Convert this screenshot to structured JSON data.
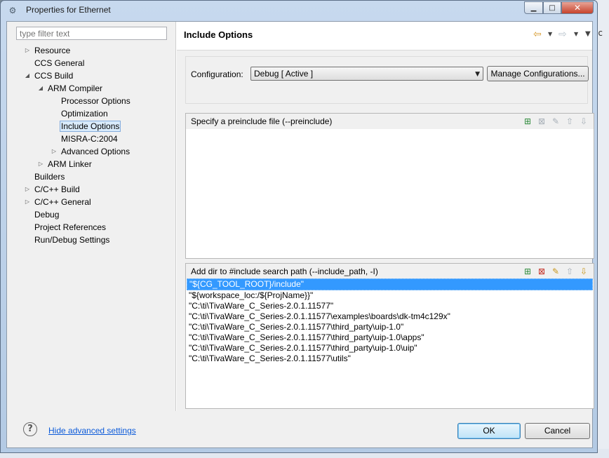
{
  "window": {
    "title": "Properties for Ethernet",
    "controls": [
      "minimize-icon",
      "maximize-icon",
      "close-icon"
    ]
  },
  "filter": {
    "placeholder": "type filter text"
  },
  "tree": {
    "items": [
      {
        "label": "Resource",
        "expander": "collapsed"
      },
      {
        "label": "CCS General",
        "expander": "none"
      },
      {
        "label": "CCS Build",
        "expander": "expanded"
      },
      {
        "label": "ARM Compiler",
        "expander": "expanded"
      },
      {
        "label": "Processor Options",
        "expander": "none"
      },
      {
        "label": "Optimization",
        "expander": "none"
      },
      {
        "label": "Include Options",
        "expander": "none",
        "selected": true
      },
      {
        "label": "MISRA-C:2004",
        "expander": "none"
      },
      {
        "label": "Advanced Options",
        "expander": "collapsed"
      },
      {
        "label": "ARM Linker",
        "expander": "collapsed"
      },
      {
        "label": "Builders",
        "expander": "none"
      },
      {
        "label": "C/C++ Build",
        "expander": "collapsed"
      },
      {
        "label": "C/C++ General",
        "expander": "collapsed"
      },
      {
        "label": "Debug",
        "expander": "none"
      },
      {
        "label": "Project References",
        "expander": "none"
      },
      {
        "label": "Run/Debug Settings",
        "expander": "none"
      }
    ]
  },
  "page": {
    "title": "Include Options"
  },
  "config": {
    "label": "Configuration:",
    "selected": "Debug  [ Active ]",
    "manage_label": "Manage Configurations..."
  },
  "preinclude": {
    "title": "Specify a preinclude file (--preinclude)",
    "items": []
  },
  "include_path": {
    "title": "Add dir to #include search path (--include_path, -I)",
    "items": [
      "\"${CG_TOOL_ROOT}/include\"",
      "\"${workspace_loc:/${ProjName}}\"",
      "\"C:\\ti\\TivaWare_C_Series-2.0.1.11577\"",
      "\"C:\\ti\\TivaWare_C_Series-2.0.1.11577\\examples\\boards\\dk-tm4c129x\"",
      "\"C:\\ti\\TivaWare_C_Series-2.0.1.11577\\third_party\\uip-1.0\"",
      "\"C:\\ti\\TivaWare_C_Series-2.0.1.11577\\third_party\\uip-1.0\\apps\"",
      "\"C:\\ti\\TivaWare_C_Series-2.0.1.11577\\third_party\\uip-1.0\\uip\"",
      "\"C:\\ti\\TivaWare_C_Series-2.0.1.11577\\utils\""
    ],
    "selected_index": 0
  },
  "footer": {
    "hide_link": "Hide advanced settings",
    "ok": "OK",
    "cancel": "Cancel"
  },
  "colors": {
    "selection": "#3399ff",
    "link": "#0b5ad9",
    "title_gradient": "#c7d9ee"
  }
}
